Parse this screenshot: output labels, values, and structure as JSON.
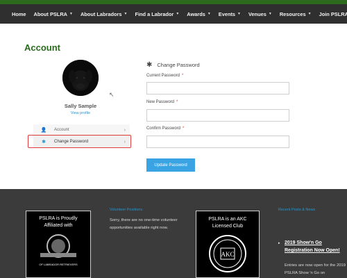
{
  "nav": {
    "items": [
      {
        "label": "Home",
        "caret": false
      },
      {
        "label": "About PSLRA",
        "caret": true
      },
      {
        "label": "About Labradors",
        "caret": true
      },
      {
        "label": "Find a Labrador",
        "caret": true
      },
      {
        "label": "Awards",
        "caret": true
      },
      {
        "label": "Events",
        "caret": true
      },
      {
        "label": "Venues",
        "caret": true
      },
      {
        "label": "Resources",
        "caret": true
      },
      {
        "label": "Join PSLRA",
        "caret": true
      }
    ]
  },
  "page": {
    "title": "Account"
  },
  "profile": {
    "name": "Sally Sample",
    "view_profile": "View profile"
  },
  "account_menu": {
    "items": [
      {
        "label": "Account",
        "icon": "user-icon"
      },
      {
        "label": "Change Password",
        "icon": "gear-icon"
      }
    ]
  },
  "change_password": {
    "heading": "Change Password",
    "current_label": "Current Password",
    "new_label": "New Password",
    "confirm_label": "Confirm Password",
    "required_mark": "*",
    "submit_label": "Update Password"
  },
  "footer": {
    "badge1_text": "PSLRA is Proudly Affiliated with",
    "badge1_caption": "OF LABRADOR RETRIEVERS",
    "volunteer_heading": "Volunteer Positions",
    "volunteer_text": "Sorry, there are no one-time volunteer opportunities available right now.",
    "badge2_text": "PSLRA is an AKC Licensed Club",
    "badge2_logo": "AKC",
    "news_heading": "Recent Posts & News",
    "news_title": "2019 Show'n Go Registration Now Open!",
    "news_body": "Entries are now open for the 2019 PSLRA Show 'n Go on"
  },
  "colors": {
    "brand_green": "#2c6b1e",
    "accent_blue": "#3aa3e3",
    "highlight_red": "#e03a3a",
    "nav_bg": "#2f2f2f",
    "footer_bg": "#3b3b3b"
  }
}
